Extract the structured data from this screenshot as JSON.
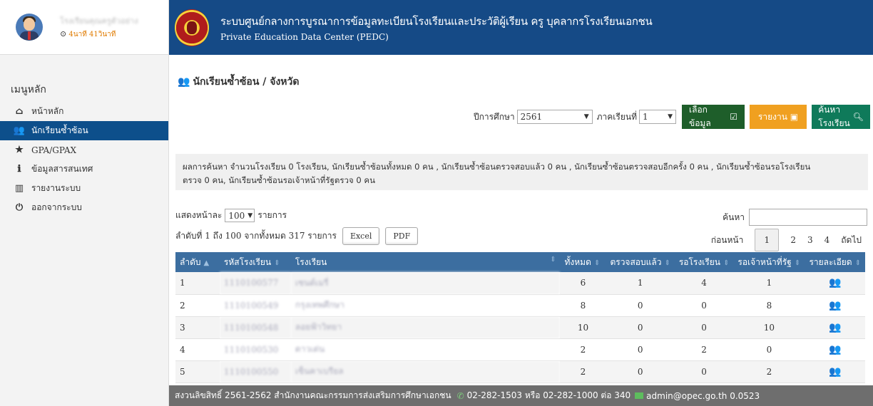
{
  "profile": {
    "name": "โรงเรียนคุณครูตัวอย่าง",
    "time": "4นาที 41วินาที"
  },
  "menu": {
    "title": "เมนูหลัก",
    "items": [
      {
        "label": "หน้าหลัก",
        "icon": "home-icon"
      },
      {
        "label": "นักเรียนซ้ำซ้อน",
        "icon": "users-icon"
      },
      {
        "label": "GPA/GPAX",
        "icon": "star-icon"
      },
      {
        "label": "ข้อมูลสารสนเทศ",
        "icon": "info-icon"
      },
      {
        "label": "รายงานระบบ",
        "icon": "bar-chart-icon"
      },
      {
        "label": "ออกจากระบบ",
        "icon": "power-icon"
      }
    ]
  },
  "header": {
    "title": "ระบบศูนย์กลางการบูรณาการข้อมูลทะเบียนโรงเรียนและประวัติผู้เรียน ครู บุคลากรโรงเรียนเอกชน",
    "subtitle": "Private Education Data Center (PEDC)"
  },
  "page": {
    "title": "นักเรียนซ้ำซ้อน / จังหวัด"
  },
  "filters": {
    "year_label": "ปีการศึกษา",
    "year_value": "2561",
    "term_label": "ภาคเรียนที่",
    "term_value": "1",
    "select_button": "เลือกข้อมูล",
    "report_button": "รายงาน",
    "search_school_button": "ค้นหาโรงเรียน"
  },
  "summary": {
    "line1": "ผลการค้นหา จำนวนโรงเรียน 0 โรงเรียน, นักเรียนซ้ำซ้อนทั้งหมด 0 คน , นักเรียนซ้ำซ้อนตรวจสอบแล้ว 0 คน , นักเรียนซ้ำซ้อนตรวจสอบอีกครั้ง 0 คน , นักเรียนซ้ำซ้อนรอโรงเรียน",
    "line2": "ตรวจ 0 คน, นักเรียนซ้ำซ้อนรอเจ้าหน้าที่รัฐตรวจ 0 คน"
  },
  "table_controls": {
    "show_prefix": "แสดงหน้าละ",
    "page_size": "100",
    "show_suffix": "รายการ",
    "info": "ลำดับที่ 1 ถึง 100 จากทั้งหมด 317 รายการ",
    "excel_label": "Excel",
    "pdf_label": "PDF",
    "search_label": "ค้นหา",
    "prev_label": "ก่อนหน้า",
    "pages": [
      "1",
      "2",
      "3",
      "4"
    ],
    "next_label": "ถัดไป"
  },
  "table": {
    "columns": [
      "ลำดับ",
      "รหัสโรงเรียน",
      "โรงเรียน",
      "ทั้งหมด",
      "ตรวจสอบแล้ว",
      "รอโรงเรียน",
      "รอเจ้าหน้าที่รัฐ",
      "รายละเอียด"
    ],
    "rows": [
      {
        "no": "1",
        "code": "1110100577",
        "school": "เซนต์เมรี่",
        "total": "6",
        "checked": "1",
        "wait_school": "4",
        "wait_gov": "1"
      },
      {
        "no": "2",
        "code": "1110100549",
        "school": "กรุงเทพศึกษา",
        "total": "8",
        "checked": "0",
        "wait_school": "0",
        "wait_gov": "8"
      },
      {
        "no": "3",
        "code": "1110100548",
        "school": "ลอยฟ้าวิทยา",
        "total": "10",
        "checked": "0",
        "wait_school": "0",
        "wait_gov": "10"
      },
      {
        "no": "4",
        "code": "1110100530",
        "school": "ดาวเด่น",
        "total": "2",
        "checked": "0",
        "wait_school": "2",
        "wait_gov": "0"
      },
      {
        "no": "5",
        "code": "1110100550",
        "school": "เซ็นคาเบรียล",
        "total": "2",
        "checked": "0",
        "wait_school": "0",
        "wait_gov": "2"
      }
    ]
  },
  "footer": {
    "copyright": "สงวนลิขสิทธิ์ 2561-2562 สำนักงานคณะกรรมการส่งเสริมการศึกษาเอกชน",
    "phone": "02-282-1503 หรือ 02-282-1000 ต่อ 340",
    "email": "admin@opec.go.th 0.0523"
  }
}
